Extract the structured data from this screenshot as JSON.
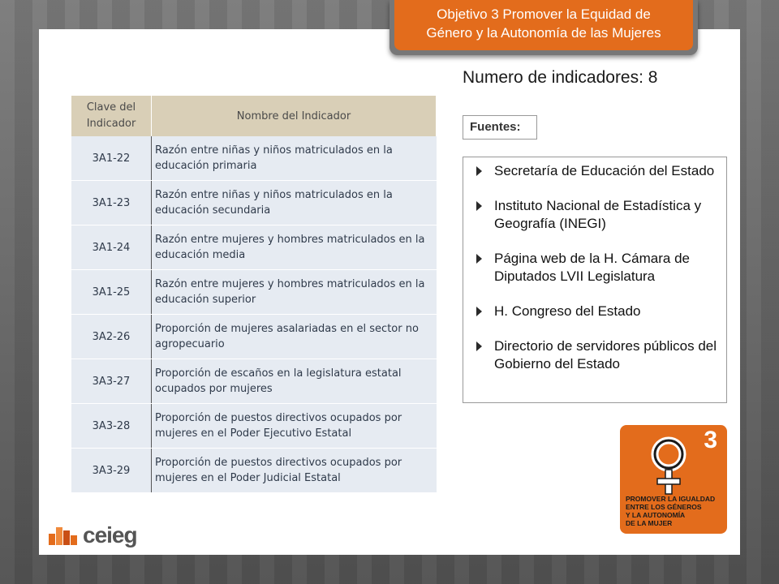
{
  "banner": {
    "line1": "Objetivo 3 Promover la Equidad de",
    "line2": "Género y la Autonomía de las Mujeres"
  },
  "indicator_count_label": "Numero de indicadores:  8",
  "table": {
    "headers": [
      "Clave del Indicador",
      "Nombre del Indicador"
    ],
    "rows": [
      {
        "code": "3A1-22",
        "name": "Razón entre niñas y niños matriculados en la educación primaria"
      },
      {
        "code": "3A1-23",
        "name": "Razón entre niñas y niños matriculados en la educación secundaria"
      },
      {
        "code": "3A1-24",
        "name": "Razón entre mujeres y hombres matriculados en la educación  media"
      },
      {
        "code": "3A1-25",
        "name": "Razón entre mujeres y hombres matriculados en la educación  superior"
      },
      {
        "code": "3A2-26",
        "name": "Proporción de mujeres asalariadas en el sector no agropecuario"
      },
      {
        "code": "3A3-27",
        "name": "Proporción de escaños en la legislatura estatal ocupados por mujeres"
      },
      {
        "code": "3A3-28",
        "name": "Proporción de puestos directivos ocupados por mujeres en el Poder Ejecutivo Estatal"
      },
      {
        "code": "3A3-29",
        "name": "Proporción de puestos directivos ocupados por mujeres en el Poder Judicial Estatal"
      }
    ]
  },
  "fuentes_label": "Fuentes:",
  "sources": [
    "Secretaría de Educación del Estado",
    "Instituto Nacional de Estadística y Geografía (INEGI)",
    "Página web de la H. Cámara de Diputados LVII Legislatura",
    "H. Congreso del Estado",
    "Directorio de servidores públicos del Gobierno del Estado"
  ],
  "sdg_badge": {
    "number": "3",
    "caption": [
      "PROMOVER LA IGUALDAD",
      "ENTRE LOS GÉNEROS",
      "Y LA AUTONOMÍA",
      "DE LA MUJER"
    ],
    "color": "#e36c1c"
  },
  "logo": {
    "text": "ceieg"
  },
  "colors": {
    "accent": "#e36c1c",
    "table_header": "#d9cfb7",
    "table_row": "#e6ebf2"
  }
}
